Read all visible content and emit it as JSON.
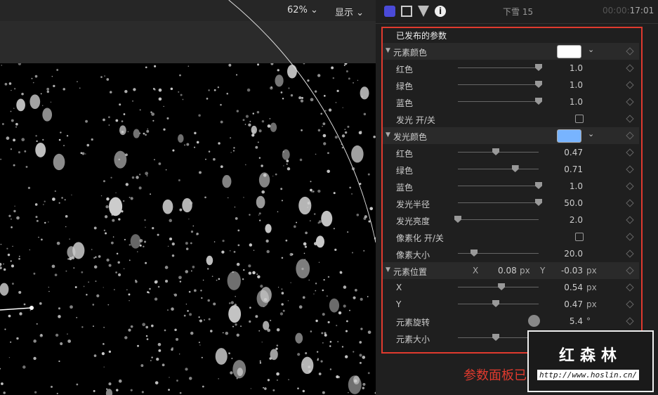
{
  "viewer": {
    "zoom": "62%",
    "display": "显示"
  },
  "inspector": {
    "title": "下雪 15",
    "timecode_dim": "00:00:",
    "timecode": "17:01",
    "section": "已发布的参数"
  },
  "rows": [
    {
      "type": "group",
      "label": "元素颜色",
      "color": "#ffffff"
    },
    {
      "type": "slider",
      "label": "红色",
      "value": "1.0",
      "pos": 1.0
    },
    {
      "type": "slider",
      "label": "绿色",
      "value": "1.0",
      "pos": 1.0
    },
    {
      "type": "slider",
      "label": "蓝色",
      "value": "1.0",
      "pos": 1.0
    },
    {
      "type": "check",
      "label": "发光 开/关"
    },
    {
      "type": "group",
      "label": "发光颜色",
      "color": "#78b4ff"
    },
    {
      "type": "slider",
      "label": "红色",
      "value": "0.47",
      "pos": 0.47
    },
    {
      "type": "slider",
      "label": "绿色",
      "value": "0.71",
      "pos": 0.71
    },
    {
      "type": "slider",
      "label": "蓝色",
      "value": "1.0",
      "pos": 1.0
    },
    {
      "type": "slider",
      "label": "发光半径",
      "value": "50.0",
      "pos": 1.0
    },
    {
      "type": "slider",
      "label": "发光亮度",
      "value": "2.0",
      "pos": 0.0
    },
    {
      "type": "check",
      "label": "像素化 开/关"
    },
    {
      "type": "slider",
      "label": "像素大小",
      "value": "20.0",
      "pos": 0.2
    },
    {
      "type": "point",
      "label": "元素位置",
      "x_label": "X",
      "x": "0.08",
      "y_label": "Y",
      "y": "-0.03",
      "unit": "px"
    },
    {
      "type": "slider",
      "label": "X",
      "value": "0.54",
      "pos": 0.54,
      "unit": "px"
    },
    {
      "type": "slider",
      "label": "Y",
      "value": "0.47",
      "pos": 0.47,
      "unit": "px"
    },
    {
      "type": "dial",
      "label": "元素旋转",
      "value": "5.4",
      "unit": "°"
    },
    {
      "type": "slider",
      "label": "元素大小",
      "value": "0.47",
      "pos": 0.47
    }
  ],
  "annotation": "参数面板已汉化",
  "watermark": {
    "name": "红森林",
    "url": "http://www.hoslin.cn/"
  },
  "colors": {
    "highlight": "#e03a2e",
    "accent": "#5a5ae6"
  }
}
